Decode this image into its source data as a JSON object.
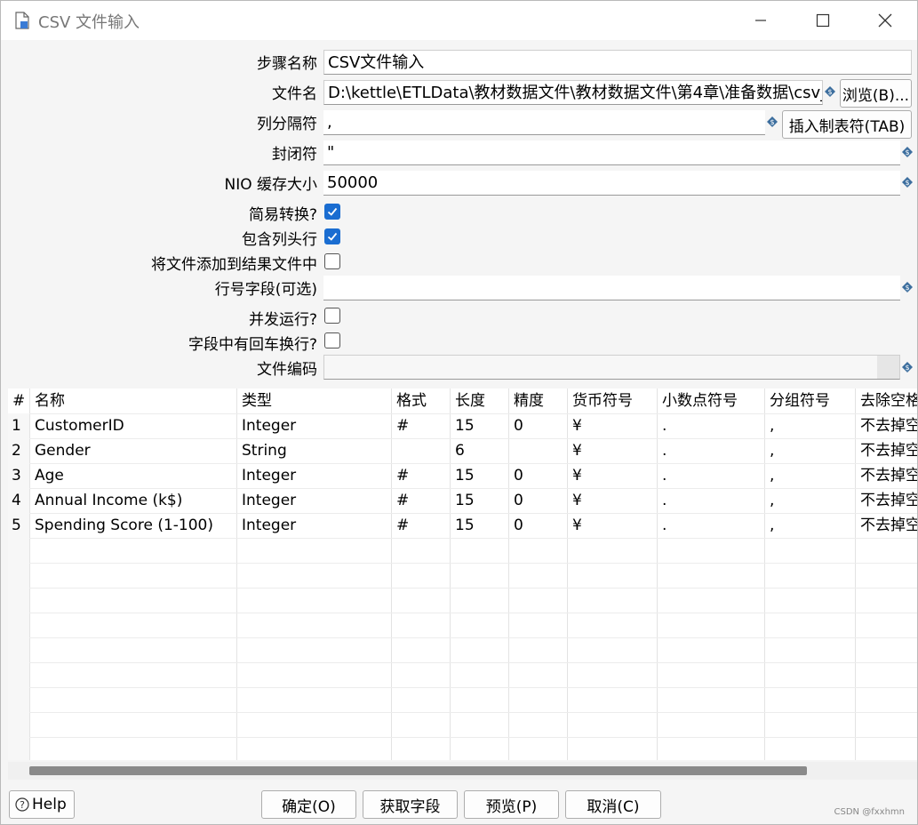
{
  "window": {
    "title": "CSV 文件输入",
    "icons": {
      "app": "document-icon",
      "min": "minimize-icon",
      "max": "maximize-icon",
      "close": "close-icon"
    }
  },
  "form": {
    "step_name": {
      "label": "步骤名称",
      "value": "CSV文件输入"
    },
    "filename": {
      "label": "文件名",
      "value": "D:\\kettle\\ETLData\\教材数据文件\\教材数据文件\\第4章\\准备数据\\csv_",
      "browse": "浏览(B)..."
    },
    "delimiter": {
      "label": "列分隔符",
      "value": ",",
      "insert_tab": "插入制表符(TAB)"
    },
    "enclosure": {
      "label": "封闭符",
      "value": "\""
    },
    "nio_buffer": {
      "label": "NIO 缓存大小",
      "value": "50000"
    },
    "lazy_conversion": {
      "label": "简易转换?",
      "checked": true
    },
    "header_row": {
      "label": "包含列头行",
      "checked": true
    },
    "add_to_result": {
      "label": "将文件添加到结果文件中",
      "checked": false
    },
    "rownum_field": {
      "label": "行号字段(可选)",
      "value": ""
    },
    "parallel": {
      "label": "并发运行?",
      "checked": false
    },
    "newline_in_fields": {
      "label": "字段中有回车换行?",
      "checked": false
    },
    "encoding": {
      "label": "文件编码",
      "value": ""
    }
  },
  "table": {
    "columns": [
      "#",
      "名称",
      "类型",
      "格式",
      "长度",
      "精度",
      "货币符号",
      "小数点符号",
      "分组符号",
      "去除空格"
    ],
    "rows": [
      [
        "1",
        "CustomerID",
        "Integer",
        "#",
        "15",
        "0",
        "¥",
        ".",
        ",",
        "不去掉空格"
      ],
      [
        "2",
        "Gender",
        "String",
        "",
        "6",
        "",
        "¥",
        ".",
        ",",
        "不去掉空格"
      ],
      [
        "3",
        "Age",
        "Integer",
        "#",
        "15",
        "0",
        "¥",
        ".",
        ",",
        "不去掉空格"
      ],
      [
        "4",
        "Annual Income (k$)",
        "Integer",
        "#",
        "15",
        "0",
        "¥",
        ".",
        ",",
        "不去掉空格"
      ],
      [
        "5",
        "Spending Score (1-100)",
        "Integer",
        "#",
        "15",
        "0",
        "¥",
        ".",
        ",",
        "不去掉空格"
      ]
    ]
  },
  "buttons": {
    "help": "Help",
    "ok": "确定(O)",
    "get_fields": "获取字段",
    "preview": "预览(P)",
    "cancel": "取消(C)"
  },
  "watermark": "CSDN @fxxhmn",
  "colors": {
    "checkbox_on": "#1a6dd1",
    "scroll_thumb": "#8a8a8a"
  }
}
